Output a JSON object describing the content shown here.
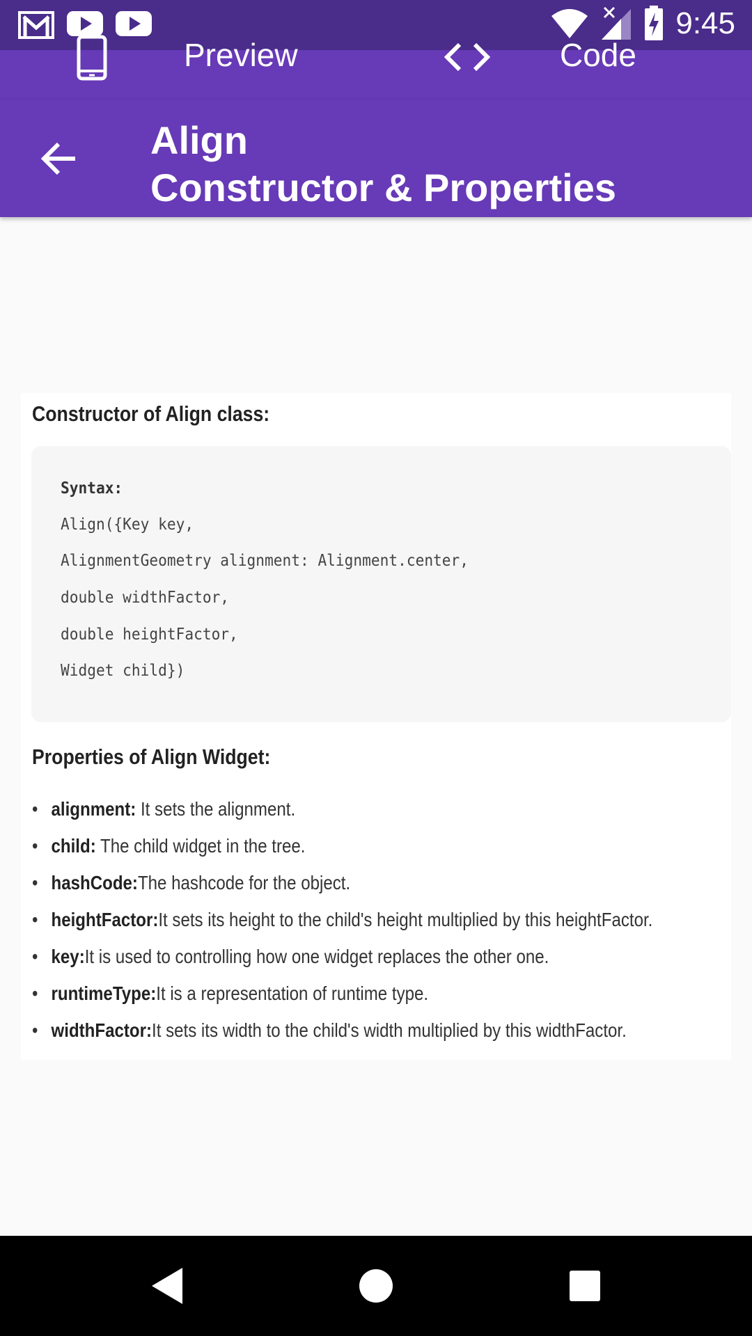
{
  "status_bar": {
    "time": "9:45",
    "left_icons": [
      "gmail-icon",
      "youtube-icon",
      "youtube-icon"
    ],
    "right_icons": [
      "wifi-icon",
      "signal-icon",
      "battery-charging-icon"
    ]
  },
  "tabs": [
    {
      "label": "Preview",
      "icon": "phone-icon",
      "selected": true
    },
    {
      "label": "Code",
      "icon": "code-icon",
      "selected": false
    }
  ],
  "appbar": {
    "title_line1": "Align",
    "title_line2": "Constructor & Properties"
  },
  "content": {
    "constructor_heading": "Constructor of Align class:",
    "code_lines": [
      "Syntax:",
      "Align({Key key,",
      "AlignmentGeometry alignment: Alignment.center,",
      "double widthFactor,",
      "double heightFactor,",
      "Widget child})"
    ],
    "properties_heading": "Properties of Align Widget:",
    "properties": [
      {
        "name": "alignment:",
        "desc": " It sets the alignment."
      },
      {
        "name": "child:",
        "desc": " The child widget in the tree."
      },
      {
        "name": "hashCode:",
        "desc": "The hashcode for the object."
      },
      {
        "name": "heightFactor:",
        "desc": "It sets its height to the child's height multiplied by this heightFactor."
      },
      {
        "name": "key:",
        "desc": "It is used to controlling how one widget replaces the other one."
      },
      {
        "name": "runtimeType:",
        "desc": "It is a representation of runtime type."
      },
      {
        "name": "widthFactor:",
        "desc": "It sets its width to the child's width multiplied by this widthFactor."
      }
    ]
  },
  "navbar": {
    "buttons": [
      "back-icon",
      "home-icon",
      "recents-icon"
    ]
  },
  "colors": {
    "status_bar": "#4a2c8a",
    "primary": "#673ab7",
    "background": "#fafafa"
  }
}
